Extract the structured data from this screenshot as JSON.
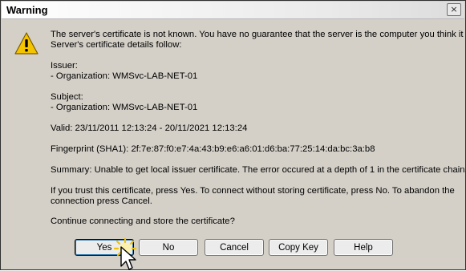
{
  "window": {
    "title": "Warning",
    "close_glyph": "×"
  },
  "icon": {
    "name": "warning-icon"
  },
  "message": {
    "line1": "The server's certificate is not known. You have no guarantee that the server is the computer you think it is.",
    "line2": "Server's certificate details follow:",
    "issuer_label": "Issuer:",
    "issuer_org": "- Organization: WMSvc-LAB-NET-01",
    "subject_label": "Subject:",
    "subject_org": "- Organization: WMSvc-LAB-NET-01",
    "valid": "Valid: 23/11/2011 12:13:24 - 20/11/2021 12:13:24",
    "fingerprint": "Fingerprint (SHA1): 2f:7e:87:f0:e7:4a:43:b9:e6:a6:01:d6:ba:77:25:14:da:bc:3a:b8",
    "summary": "Summary: Unable to get local issuer certificate. The error occured at a depth of 1 in the certificate chain.",
    "trust_line1": "If you trust this certificate, press Yes. To connect without storing certificate, press No. To abandon the",
    "trust_line2": "connection press Cancel.",
    "question": "Continue connecting and store the certificate?"
  },
  "buttons": {
    "yes": "Yes",
    "no": "No",
    "cancel": "Cancel",
    "copy_key": "Copy Key",
    "help": "Help"
  },
  "cursor": {
    "name": "mouse-pointer-icon",
    "state": "click-highlight"
  }
}
